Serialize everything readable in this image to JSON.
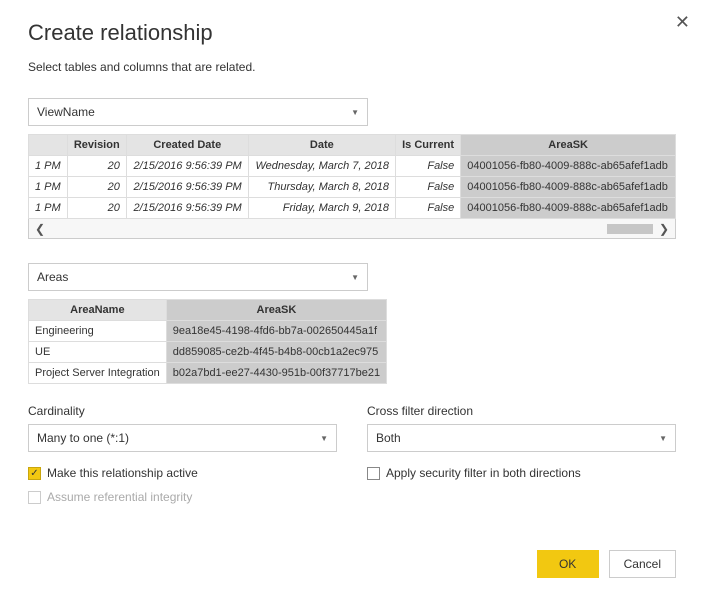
{
  "title": "Create relationship",
  "subtitle": "Select tables and columns that are related.",
  "close": "✕",
  "primaryTable": {
    "selected": "ViewName",
    "headers": [
      "Revision",
      "Created Date",
      "Date",
      "Is Current",
      "AreaSK"
    ],
    "rowPrefix": "1 PM",
    "rows": [
      {
        "revision": "20",
        "created": "2/15/2016 9:56:39 PM",
        "date": "Wednesday, March 7, 2018",
        "isCurrent": "False",
        "areaSK": "04001056-fb80-4009-888c-ab65afef1adb"
      },
      {
        "revision": "20",
        "created": "2/15/2016 9:56:39 PM",
        "date": "Thursday, March 8, 2018",
        "isCurrent": "False",
        "areaSK": "04001056-fb80-4009-888c-ab65afef1adb"
      },
      {
        "revision": "20",
        "created": "2/15/2016 9:56:39 PM",
        "date": "Friday, March 9, 2018",
        "isCurrent": "False",
        "areaSK": "04001056-fb80-4009-888c-ab65afef1adb"
      }
    ]
  },
  "secondaryTable": {
    "selected": "Areas",
    "headers": [
      "AreaName",
      "AreaSK"
    ],
    "rows": [
      {
        "name": "Engineering",
        "sk": "9ea18e45-4198-4fd6-bb7a-002650445a1f"
      },
      {
        "name": "UE",
        "sk": "dd859085-ce2b-4f45-b4b8-00cb1a2ec975"
      },
      {
        "name": "Project Server Integration",
        "sk": "b02a7bd1-ee27-4430-951b-00f37717be21"
      }
    ]
  },
  "cardinality": {
    "label": "Cardinality",
    "value": "Many to one (*:1)"
  },
  "crossFilter": {
    "label": "Cross filter direction",
    "value": "Both"
  },
  "checkboxes": {
    "active": "Make this relationship active",
    "referential": "Assume referential integrity",
    "security": "Apply security filter in both directions"
  },
  "buttons": {
    "ok": "OK",
    "cancel": "Cancel"
  }
}
